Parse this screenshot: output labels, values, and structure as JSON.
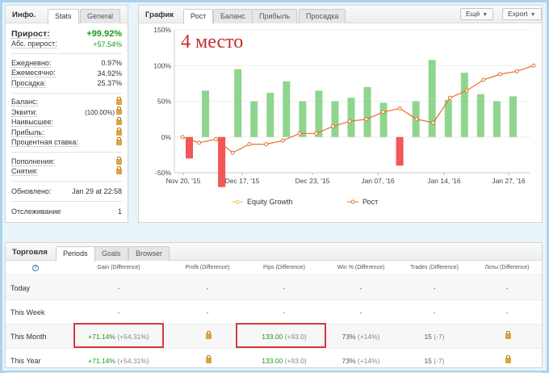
{
  "info": {
    "title": "Инфо.",
    "tabs": [
      "Stats",
      "General"
    ],
    "growth": {
      "label": "Прирост:",
      "value": "+99.92%"
    },
    "abs_growth": {
      "label": "Абс. прирост:",
      "value": "+57.54%"
    },
    "daily": {
      "label": "Ежедневно:",
      "value": "0.97%"
    },
    "monthly": {
      "label": "Ежемесячно:",
      "value": "34.92%"
    },
    "drawdown": {
      "label": "Просадка:",
      "value": "25.37%"
    },
    "balance": {
      "label": "Баланс:"
    },
    "equity": {
      "label": "Эквити:",
      "value": "(100.00%)"
    },
    "highest": {
      "label": "Наивысшее:"
    },
    "profit": {
      "label": "Прибыль:"
    },
    "interest": {
      "label": "Процентная ставка:"
    },
    "deposits": {
      "label": "Пополнения:"
    },
    "withdrawals": {
      "label": "Снятия:"
    },
    "updated": {
      "label": "Обновлено:",
      "value": "Jan 29 at 22:58"
    },
    "tracking": {
      "label": "Отслеживание",
      "value": "1"
    }
  },
  "chart_panel": {
    "title": "График",
    "tabs": [
      "Рост",
      "Баланс",
      "Прибыль",
      "Просадка"
    ],
    "more_label": "Ещё",
    "export_label": "Export",
    "annotation": "4 место",
    "legend_equity": "Equity Growth",
    "legend_growth": "Рост"
  },
  "chart_data": {
    "type": "line",
    "yticks": [
      "150%",
      "100%",
      "50%",
      "0%",
      "-50%"
    ],
    "ylim": [
      -50,
      150
    ],
    "xticks": [
      "Nov 20, '15",
      "Dec 17, '15",
      "Dec 23, '15",
      "Jan 07, '16",
      "Jan 14, '16",
      "Jan 27, '16"
    ],
    "series": [
      {
        "name": "Рост",
        "values": [
          0,
          -8,
          -3,
          -22,
          -10,
          -10,
          -5,
          5,
          5,
          15,
          22,
          25,
          35,
          40,
          25,
          20,
          55,
          65,
          80,
          88,
          92,
          100
        ]
      }
    ],
    "bars": [
      -30,
      65,
      -70,
      95,
      50,
      62,
      78,
      50,
      65,
      50,
      55,
      70,
      48,
      -40,
      50,
      108,
      52,
      90,
      60,
      50,
      57
    ],
    "legend": "bottom",
    "grid": true
  },
  "trade": {
    "title": "Торговля",
    "tabs": [
      "Periods",
      "Goals",
      "Browser"
    ],
    "headers": [
      "Gain (Difference)",
      "Profit (Difference)",
      "Pips (Difference)",
      "Win % (Difference)",
      "Trades (Difference)",
      "Лоты (Difference)"
    ],
    "help_icon": "?",
    "rows": [
      {
        "label": "Today",
        "gain": "-",
        "gain_diff": "",
        "pips": "-",
        "pips_diff": "",
        "win": "-",
        "win_diff": "",
        "trades": "-",
        "trades_diff": "",
        "locked": false
      },
      {
        "label": "This Week",
        "gain": "-",
        "gain_diff": "",
        "pips": "-",
        "pips_diff": "",
        "win": "-",
        "win_diff": "",
        "trades": "-",
        "trades_diff": "",
        "locked": false
      },
      {
        "label": "This Month",
        "gain": "+71.14%",
        "gain_diff": "(+54.31%)",
        "pips": "133.00",
        "pips_diff": "(+93.0)",
        "win": "73%",
        "win_diff": "(+14%)",
        "trades": "15",
        "trades_diff": "(-7)",
        "locked": true
      },
      {
        "label": "This Year",
        "gain": "+71.14%",
        "gain_diff": "(+54.31%)",
        "pips": "133.00",
        "pips_diff": "(+93.0)",
        "win": "73%",
        "win_diff": "(+14%)",
        "trades": "15",
        "trades_diff": "(-7)",
        "locked": true
      }
    ]
  },
  "colors": {
    "positive_bar": "#8fd58f",
    "negative_bar": "#f25656",
    "line": "#e8702a",
    "highlight": "#d43b3b",
    "green_text": "#1a9a1a"
  }
}
